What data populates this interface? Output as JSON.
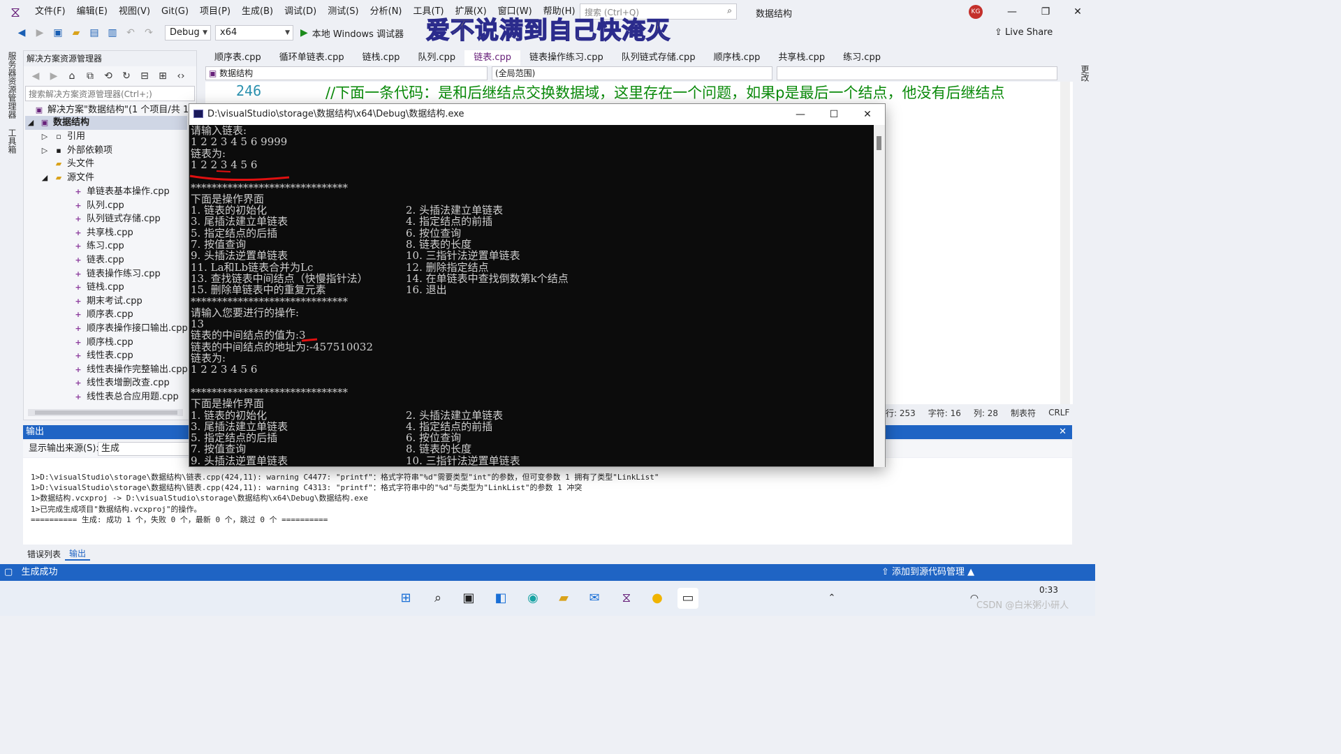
{
  "menubar": {
    "items": [
      "文件(F)",
      "编辑(E)",
      "视图(V)",
      "Git(G)",
      "项目(P)",
      "生成(B)",
      "调试(D)",
      "测试(S)",
      "分析(N)",
      "工具(T)",
      "扩展(X)",
      "窗口(W)",
      "帮助(H)"
    ],
    "search_placeholder": "搜索 (Ctrl+Q)",
    "solution_name": "数据结构",
    "avatar_initials": "KG"
  },
  "overlay_text": "爱不说满到自己快淹灭",
  "toolbar": {
    "config": "Debug",
    "platform": "x64",
    "run_label": "本地 Windows 调试器",
    "live_share": "Live Share"
  },
  "side_strip": {
    "server_explorer": "服务器资源管理器",
    "toolbox": "工具箱",
    "git_changes": "Git 更改"
  },
  "solution_explorer": {
    "title": "解决方案资源管理器",
    "search_placeholder": "搜索解决方案资源管理器(Ctrl+;)",
    "solution_row": "解决方案\"数据结构\"(1 个项目/共 1 个",
    "project": "数据结构",
    "nodes": [
      "引用",
      "外部依赖项",
      "头文件",
      "源文件"
    ],
    "files": [
      "单链表基本操作.cpp",
      "队列.cpp",
      "队列链式存储.cpp",
      "共享栈.cpp",
      "练习.cpp",
      "链表.cpp",
      "链表操作练习.cpp",
      "链栈.cpp",
      "期末考试.cpp",
      "顺序表.cpp",
      "顺序表操作接口输出.cpp",
      "顺序栈.cpp",
      "线性表.cpp",
      "线性表操作完整输出.cpp",
      "线性表增删改查.cpp",
      "线性表总合应用题.cpp"
    ]
  },
  "editor": {
    "tabs": [
      "顺序表.cpp",
      "循环单链表.cpp",
      "链栈.cpp",
      "队列.cpp",
      "链表.cpp",
      "链表操作练习.cpp",
      "队列链式存储.cpp",
      "顺序栈.cpp",
      "共享栈.cpp",
      "练习.cpp"
    ],
    "active_tab_index": 4,
    "nav_project": "数据结构",
    "nav_scope": "(全局范围)",
    "line_number": "246",
    "code_line": "//下面一条代码：是和后继结点交换数据域，这里存在一个问题，如果p是最后一个结点，他没有后继结点",
    "status": {
      "line": "行: 253",
      "char": "字符: 16",
      "col": "列: 28",
      "tab": "制表符",
      "eol": "CRLF"
    }
  },
  "console": {
    "title": "D:\\visualStudio\\storage\\数据结构\\x64\\Debug\\数据结构.exe",
    "left_lines": [
      "请输入链表:",
      "1 2 2 3 4 5 6 9999",
      "链表为:",
      "1 2 2 3 4 5 6",
      "",
      "******************************",
      "下面是操作界面",
      "1. 链表的初始化",
      "3. 尾插法建立单链表",
      "5. 指定结点的后插",
      "7. 按值查询",
      "9. 头插法逆置单链表",
      "11. La和Lb链表合并为Lc",
      "13. 查找链表中间结点（快慢指针法）",
      "15. 删除单链表中的重复元素",
      "******************************",
      "请输入您要进行的操作:",
      "13",
      "链表的中间结点的值为:3",
      "链表的中间结点的地址为:-457510032",
      "链表为:",
      "1 2 2 3 4 5 6",
      "",
      "******************************",
      "下面是操作界面",
      "1. 链表的初始化",
      "3. 尾插法建立单链表",
      "5. 指定结点的后插",
      "7. 按值查询",
      "9. 头插法逆置单链表"
    ],
    "right_lines": [
      {
        "row": 7,
        "text": "2. 头插法建立单链表"
      },
      {
        "row": 8,
        "text": "4. 指定结点的前插"
      },
      {
        "row": 9,
        "text": "6. 按位查询"
      },
      {
        "row": 10,
        "text": "8. 链表的长度"
      },
      {
        "row": 11,
        "text": "10. 三指针法逆置单链表"
      },
      {
        "row": 12,
        "text": "12. 删除指定结点"
      },
      {
        "row": 13,
        "text": "14. 在单链表中查找倒数第k个结点"
      },
      {
        "row": 14,
        "text": "16. 退出"
      },
      {
        "row": 25,
        "text": "2. 头插法建立单链表"
      },
      {
        "row": 26,
        "text": "4. 指定结点的前插"
      },
      {
        "row": 27,
        "text": "6. 按位查询"
      },
      {
        "row": 28,
        "text": "8. 链表的长度"
      },
      {
        "row": 29,
        "text": "10. 三指针法逆置单链表"
      }
    ]
  },
  "output": {
    "title": "输出",
    "source_label": "显示输出来源(S):",
    "source_value": "生成",
    "lines": [
      "1>D:\\visualStudio\\storage\\数据结构\\链表.cpp(424,11): warning C4477: \"printf\"：格式字符串\"%d\"需要类型\"int\"的参数，但可变参数 1 拥有了类型\"LinkList\"",
      "1>D:\\visualStudio\\storage\\数据结构\\链表.cpp(424,11): warning C4313: \"printf\"：格式字符串中的\"%d\"与类型为\"LinkList\"的参数 1 冲突",
      "1>数据结构.vcxproj -> D:\\visualStudio\\storage\\数据结构\\x64\\Debug\\数据结构.exe",
      "1>已完成生成项目\"数据结构.vcxproj\"的操作。",
      "========== 生成: 成功 1 个，失败 0 个，最新 0 个，跳过 0 个 =========="
    ],
    "tabs": [
      "错误列表",
      "输出"
    ]
  },
  "statusbar": {
    "left": "生成成功",
    "right": "添加到源代码管理"
  },
  "taskbar": {
    "time": "0:33",
    "csdn": "CSDN @白米粥小研人"
  },
  "colors": {
    "accent": "#1f64c4",
    "vs_purple": "#68217a",
    "comment_green": "#0a8a0a",
    "annotation_red": "#e01010"
  }
}
